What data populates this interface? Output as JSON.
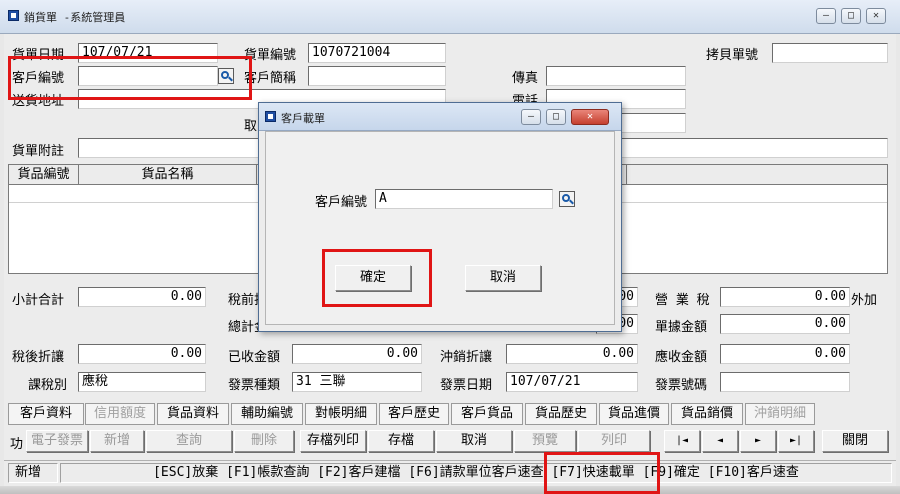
{
  "window": {
    "title": "銷貨單 -系統管理員",
    "controls": [
      "–",
      "□",
      "✕"
    ]
  },
  "header": {
    "order_date_label": "貨單日期",
    "order_date": "107/07/21",
    "order_no_label": "貨單編號",
    "order_no": "1070721004",
    "copy_no_label": "拷貝單號",
    "copy_no": "",
    "customer_no_label": "客戶編號",
    "customer_no": "",
    "customer_short_label": "客戶簡稱",
    "customer_short": "",
    "fax_label": "傳真",
    "fax": "",
    "ship_addr_label": "送貨地址",
    "ship_addr": "",
    "phone_label": "電話",
    "phone": "",
    "pickup_label": "取",
    "pickup": "",
    "note_label": "貨單附註",
    "note": ""
  },
  "grid": {
    "columns": [
      "貨品編號",
      "貨品名稱"
    ]
  },
  "totals": {
    "subtotal_label": "小計合計",
    "subtotal": "0.00",
    "pretax_label": "稅前折",
    "total_label": "總計金",
    "hidden_val1": "0.00",
    "hidden_val2": "0.00",
    "business_tax_label": "營 業 稅",
    "business_tax": "0.00",
    "tax_mode": "外加",
    "doc_amount_label": "單據金額",
    "doc_amount": "0.00",
    "after_tax_discount_label": "稅後折讓",
    "after_tax_discount": "0.00",
    "received_label": "已收金額",
    "received": "0.00",
    "offset_discount_label": "沖銷折讓",
    "offset_discount": "0.00",
    "receivable_label": "應收金額",
    "receivable": "0.00",
    "tax_type_label": "課稅別",
    "tax_type": "應稅",
    "invoice_type_label": "發票種類",
    "invoice_type": "31 三聯",
    "invoice_date_label": "發票日期",
    "invoice_date": "107/07/21",
    "invoice_no_label": "發票號碼",
    "invoice_no": ""
  },
  "tabs": [
    "客戶資料",
    "信用額度",
    "貨品資料",
    "輔助編號",
    "對帳明細",
    "客戶歷史",
    "客戶貨品",
    "貨品歷史",
    "貨品進價",
    "貨品銷價",
    "沖銷明細"
  ],
  "toolbar": {
    "func_label": "功",
    "e_invoice": "電子發票",
    "add": "新增",
    "query": "查詢",
    "delete": "刪除",
    "save_print": "存檔列印",
    "save": "存檔",
    "cancel": "取消",
    "preview": "預覽",
    "print": "列印",
    "first": "|◄",
    "prev": "◄",
    "next": "►",
    "last": "►|",
    "close": "關閉"
  },
  "status": {
    "mode": "新增",
    "hints": "[ESC]放棄 [F1]帳款查詢 [F2]客戶建檔 [F6]請款單位客戶速查 [F7]快速載單 [F9]確定 [F10]客戶速查"
  },
  "dialog": {
    "title": "客戶載單",
    "customer_no_label": "客戶編號",
    "customer_no_value": "A",
    "ok": "確定",
    "cancel": "取消"
  },
  "colors": {
    "highlight": "#e01515",
    "titlebar": "#cfdcec"
  },
  "icons": [
    "search-icon",
    "minimize-icon",
    "maximize-icon",
    "close-icon",
    "app-icon"
  ]
}
